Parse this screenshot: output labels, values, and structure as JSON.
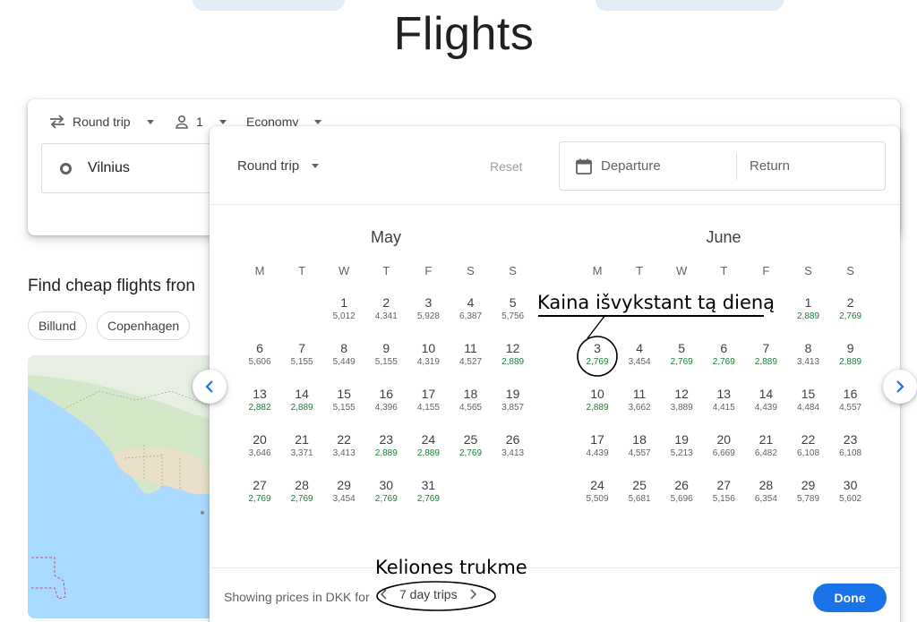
{
  "app": {
    "title": "Flights"
  },
  "search": {
    "trip_type": "Round trip",
    "passengers": "1",
    "cabin": "Economy",
    "origin": "Vilnius"
  },
  "explore": {
    "heading": "Find cheap flights fron",
    "chips": [
      "Billund",
      "Copenhagen"
    ]
  },
  "picker": {
    "trip_type": "Round trip",
    "reset_label": "Reset",
    "departure_placeholder": "Departure",
    "return_placeholder": "Return",
    "weekdays": [
      "M",
      "T",
      "W",
      "T",
      "F",
      "S",
      "S"
    ],
    "months": [
      {
        "name": "May",
        "first_weekday_index": 2,
        "days": [
          {
            "d": "1",
            "p": "5,012",
            "cheap": false
          },
          {
            "d": "2",
            "p": "4,341",
            "cheap": false
          },
          {
            "d": "3",
            "p": "5,928",
            "cheap": false
          },
          {
            "d": "4",
            "p": "6,387",
            "cheap": false
          },
          {
            "d": "5",
            "p": "5,756",
            "cheap": false
          },
          {
            "d": "6",
            "p": "5,606",
            "cheap": false
          },
          {
            "d": "7",
            "p": "5,155",
            "cheap": false
          },
          {
            "d": "8",
            "p": "5,449",
            "cheap": false
          },
          {
            "d": "9",
            "p": "5,155",
            "cheap": false
          },
          {
            "d": "10",
            "p": "4,319",
            "cheap": false
          },
          {
            "d": "11",
            "p": "4,527",
            "cheap": false
          },
          {
            "d": "12",
            "p": "2,889",
            "cheap": true
          },
          {
            "d": "13",
            "p": "2,882",
            "cheap": true
          },
          {
            "d": "14",
            "p": "2,889",
            "cheap": true
          },
          {
            "d": "15",
            "p": "5,155",
            "cheap": false
          },
          {
            "d": "16",
            "p": "4,396",
            "cheap": false
          },
          {
            "d": "17",
            "p": "4,155",
            "cheap": false
          },
          {
            "d": "18",
            "p": "4,565",
            "cheap": false
          },
          {
            "d": "19",
            "p": "3,857",
            "cheap": false
          },
          {
            "d": "20",
            "p": "3,646",
            "cheap": false
          },
          {
            "d": "21",
            "p": "3,371",
            "cheap": false
          },
          {
            "d": "22",
            "p": "3,413",
            "cheap": false
          },
          {
            "d": "23",
            "p": "2,889",
            "cheap": true
          },
          {
            "d": "24",
            "p": "2,889",
            "cheap": true
          },
          {
            "d": "25",
            "p": "2,769",
            "cheap": true
          },
          {
            "d": "26",
            "p": "3,413",
            "cheap": false
          },
          {
            "d": "27",
            "p": "2,769",
            "cheap": true
          },
          {
            "d": "28",
            "p": "2,769",
            "cheap": true
          },
          {
            "d": "29",
            "p": "3,454",
            "cheap": false
          },
          {
            "d": "30",
            "p": "2,769",
            "cheap": true
          },
          {
            "d": "31",
            "p": "2,769",
            "cheap": true
          }
        ]
      },
      {
        "name": "June",
        "first_weekday_index": 5,
        "days": [
          {
            "d": "1",
            "p": "2,889",
            "cheap": true
          },
          {
            "d": "2",
            "p": "2,769",
            "cheap": true
          },
          {
            "d": "3",
            "p": "2,769",
            "cheap": true
          },
          {
            "d": "4",
            "p": "3,454",
            "cheap": false
          },
          {
            "d": "5",
            "p": "2,769",
            "cheap": true
          },
          {
            "d": "6",
            "p": "2,769",
            "cheap": true
          },
          {
            "d": "7",
            "p": "2,889",
            "cheap": true
          },
          {
            "d": "8",
            "p": "3,413",
            "cheap": false
          },
          {
            "d": "9",
            "p": "2,889",
            "cheap": true
          },
          {
            "d": "10",
            "p": "2,889",
            "cheap": true
          },
          {
            "d": "11",
            "p": "3,662",
            "cheap": false
          },
          {
            "d": "12",
            "p": "3,889",
            "cheap": false
          },
          {
            "d": "13",
            "p": "4,415",
            "cheap": false
          },
          {
            "d": "14",
            "p": "4,439",
            "cheap": false
          },
          {
            "d": "15",
            "p": "4,484",
            "cheap": false
          },
          {
            "d": "16",
            "p": "4,557",
            "cheap": false
          },
          {
            "d": "17",
            "p": "4,439",
            "cheap": false
          },
          {
            "d": "18",
            "p": "4,557",
            "cheap": false
          },
          {
            "d": "19",
            "p": "5,213",
            "cheap": false
          },
          {
            "d": "20",
            "p": "6,669",
            "cheap": false
          },
          {
            "d": "21",
            "p": "6,482",
            "cheap": false
          },
          {
            "d": "22",
            "p": "6,108",
            "cheap": false
          },
          {
            "d": "23",
            "p": "6,108",
            "cheap": false
          },
          {
            "d": "24",
            "p": "5,509",
            "cheap": false
          },
          {
            "d": "25",
            "p": "5,681",
            "cheap": false
          },
          {
            "d": "26",
            "p": "5,696",
            "cheap": false
          },
          {
            "d": "27",
            "p": "5,156",
            "cheap": false
          },
          {
            "d": "28",
            "p": "6,354",
            "cheap": false
          },
          {
            "d": "29",
            "p": "5,789",
            "cheap": false
          },
          {
            "d": "30",
            "p": "5,602",
            "cheap": false
          }
        ]
      }
    ],
    "footer": {
      "showing_label": "Showing prices in DKK for",
      "trip_length": "7 day trips",
      "done_label": "Done"
    }
  },
  "annotations": {
    "price_note": "Kaina išvykstant tą dieną",
    "duration_note": "Keliones trukme"
  },
  "colors": {
    "accent": "#1a73e8",
    "cheap_price": "#188038"
  }
}
